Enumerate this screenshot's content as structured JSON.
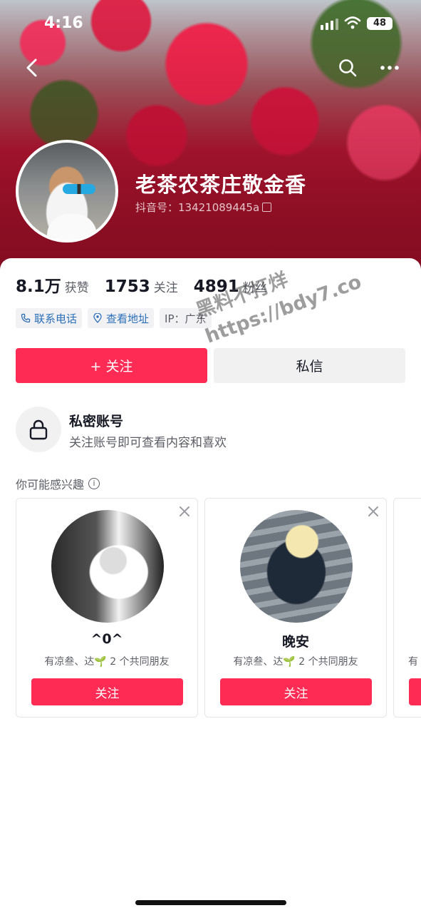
{
  "status": {
    "time": "4:16",
    "battery": "48"
  },
  "profile": {
    "nickname": "老茶农茶庄敬金香",
    "douyin_id": "抖音号：13421089445a"
  },
  "stats": [
    {
      "value": "8.1万",
      "label": "获赞"
    },
    {
      "value": "1753",
      "label": "关注"
    },
    {
      "value": "4891",
      "label": "粉丝"
    }
  ],
  "tags": {
    "phone": "联系电话",
    "address": "查看地址",
    "ip": "IP：广东"
  },
  "actions": {
    "follow": "+ 关注",
    "message": "私信"
  },
  "private": {
    "title": "私密账号",
    "desc": "关注账号即可查看内容和喜欢"
  },
  "suggest": {
    "title": "你可能感兴趣",
    "cards": [
      {
        "name": "^0^",
        "mutual": "有凉叁、达🌱 2 个共同朋友",
        "button": "关注"
      },
      {
        "name": "晚安",
        "mutual": "有凉叁、达🌱 2 个共同朋友",
        "button": "关注"
      },
      {
        "name": "",
        "mutual": "有",
        "button": ""
      }
    ]
  },
  "watermark": {
    "line1": "黑料不打烊",
    "line2": "https://bdy7.co"
  },
  "colors": {
    "accent": "#fe2c55",
    "link": "#2b6fb8",
    "secondary_bg": "#f1f1f2"
  }
}
